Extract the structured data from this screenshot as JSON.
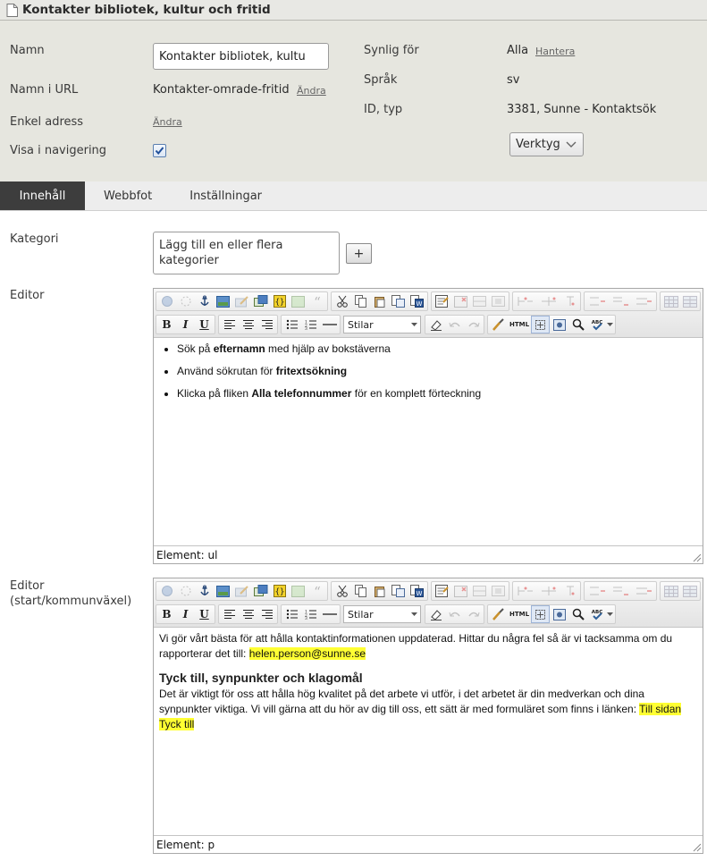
{
  "page": {
    "title": "Kontakter bibliotek, kultur och fritid"
  },
  "properties": {
    "name_label": "Namn",
    "name_value": "Kontakter bibliotek, kultu",
    "url_label": "Namn i URL",
    "url_value": "Kontakter-omrade-fritid",
    "url_change": "Ändra",
    "simple_label": "Enkel adress",
    "simple_change": "Ändra",
    "nav_label": "Visa i navigering",
    "nav_checked": true,
    "visible_label": "Synlig för",
    "visible_value": "Alla",
    "visible_manage": "Hantera",
    "lang_label": "Språk",
    "lang_value": "sv",
    "id_label": "ID, typ",
    "id_value": "3381, Sunne - Kontaktsök",
    "tools_label": "Verktyg"
  },
  "tabs": [
    {
      "label": "Innehåll",
      "active": true
    },
    {
      "label": "Webbfot",
      "active": false
    },
    {
      "label": "Inställningar",
      "active": false
    }
  ],
  "main": {
    "category_label": "Kategori",
    "category_placeholder": "Lägg till en eller flera kategorier",
    "add_button": "+",
    "editor1_label": "Editor",
    "editor2_label": "Editor (start/kommunväxel)"
  },
  "toolbar": {
    "styles_label": "Stilar",
    "bold": "B",
    "italic": "I",
    "underline": "U",
    "html": "HTML"
  },
  "editor1": {
    "items": [
      {
        "pre": "Sök på ",
        "strong": "efternamn",
        "post": " med hjälp av bokstäverna"
      },
      {
        "pre": "Använd sökrutan för ",
        "strong": "fritextsökning",
        "post": ""
      },
      {
        "pre": "Klicka på fliken ",
        "strong": "Alla telefonnummer",
        "post": " för en komplett förteckning"
      }
    ],
    "status": "Element: ul"
  },
  "editor2": {
    "p1": "Vi gör vårt bästa för att hålla kontaktinformationen uppdaterad. Hittar du några fel så är vi tacksamma om du rapporterar det till: ",
    "email": "helen.person@sunne.se",
    "heading": "Tyck till, synpunkter och klagomål",
    "p2": "Det är viktigt för oss att hålla hög kvalitet på det arbete vi utför, i det arbetet är din medverkan och dina synpunkter viktiga. Vi vill gärna att du hör av dig till oss, ett sätt är med formuläret som finns i länken: ",
    "link": "Till sidan Tyck till",
    "status": "Element: p"
  },
  "colors": {
    "panel_bg": "#e6e6df",
    "active_tab": "#3d3d3d",
    "highlight": "#ffff33"
  }
}
